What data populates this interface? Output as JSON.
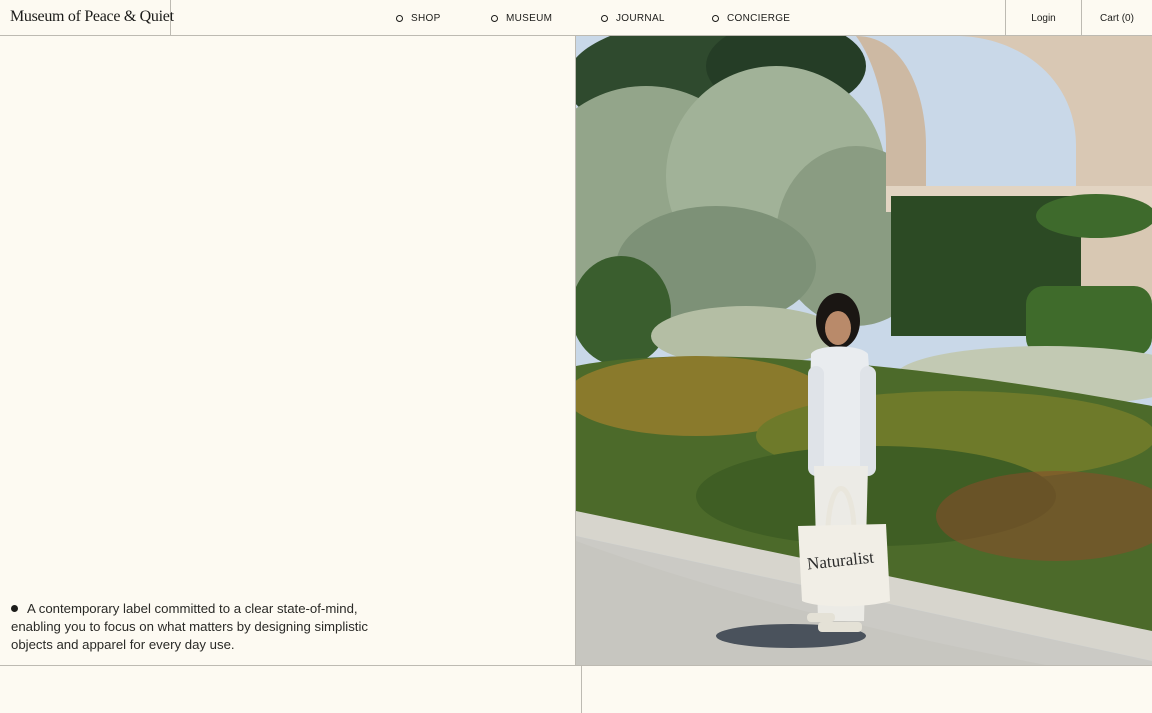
{
  "brand": {
    "logo": "Museum of Peace & Quiet"
  },
  "nav": {
    "items": [
      {
        "label": "SHOP"
      },
      {
        "label": "MUSEUM"
      },
      {
        "label": "JOURNAL"
      },
      {
        "label": "CONCIERGE"
      }
    ]
  },
  "header_actions": {
    "login": "Login",
    "cart": "Cart (0)"
  },
  "hero": {
    "tagline": "A contemporary label committed to a clear state-of-mind, enabling you to focus on what matters by designing simplistic objects and apparel for every day use.",
    "image": {
      "tote_text": "Naturalist"
    }
  },
  "colors": {
    "background": "#fdfaf2",
    "text": "#1c1c1a",
    "rule": "#bdbab2"
  }
}
